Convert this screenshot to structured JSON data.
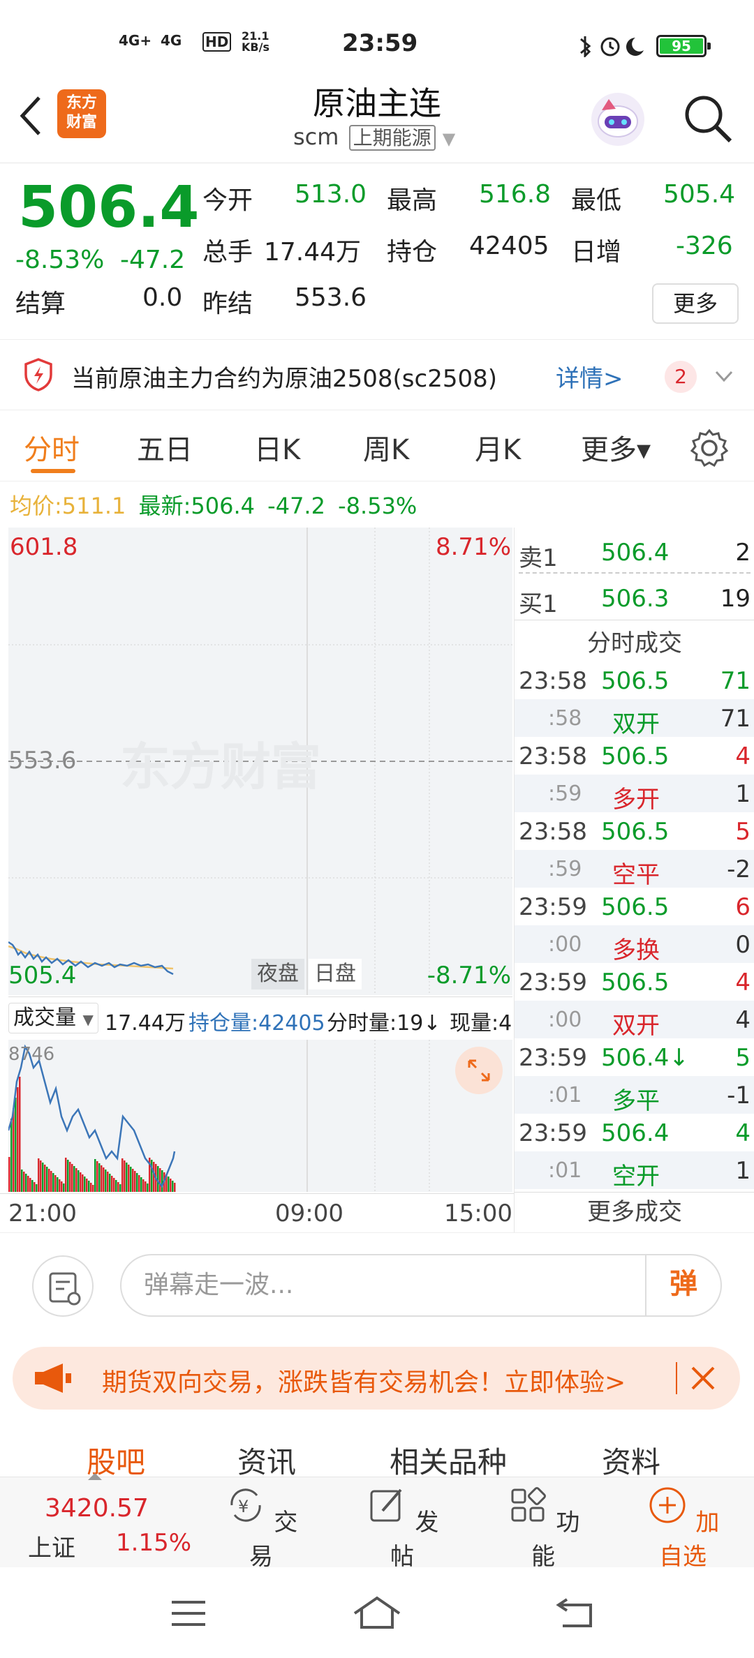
{
  "status_bar": {
    "time": "23:59",
    "net1": "4G+",
    "net2": "4G",
    "hd": "HD",
    "speed": "21.1",
    "speed_unit": "KB/s",
    "battery": "95"
  },
  "header": {
    "logo_text_1": "东方",
    "logo_text_2": "财富",
    "title": "原油主连",
    "code": "scm",
    "exchange": "上期能源"
  },
  "quote": {
    "price": "506.4",
    "change_pct": "-8.53%",
    "change": "-47.2",
    "open_label": "今开",
    "open": "513.0",
    "high_label": "最高",
    "high": "516.8",
    "low_label": "最低",
    "low": "505.4",
    "volume_label": "总手",
    "volume": "17.44万",
    "oi_label": "持仓",
    "oi": "42405",
    "oi_change_label": "日增",
    "oi_change": "-326",
    "settle_label": "结算",
    "settle": "0.0",
    "prev_settle_label": "昨结",
    "prev_settle": "553.6",
    "more": "更多"
  },
  "notice": {
    "text": "当前原油主力合约为原油2508(sc2508)",
    "link": "详情>",
    "count": "2"
  },
  "tabs": [
    "分时",
    "五日",
    "日K",
    "周K",
    "月K",
    "更多▾"
  ],
  "avg_line": {
    "avg_label": "均价:",
    "avg": "511.1",
    "latest_label": "最新:",
    "latest": "506.4",
    "change": "-47.2",
    "pct": "-8.53%"
  },
  "chart": {
    "top_price": "601.8",
    "top_pct": "8.71%",
    "mid_price": "553.6",
    "bottom_price": "505.4",
    "bottom_pct": "-8.71%",
    "watermark": "东方财富",
    "night_label": "夜盘",
    "day_label": "日盘"
  },
  "volume_bar": {
    "label": "成交量",
    "volume": "17.44万",
    "oi_text": "持仓量:42405",
    "tick_vol": "分时量:19↓",
    "now_vol": "现量:4",
    "max": "8746"
  },
  "time_axis": [
    "21:00",
    "09:00",
    "15:00"
  ],
  "book": {
    "sell_label": "卖1",
    "sell_price": "506.4",
    "sell_qty": "2",
    "buy_label": "买1",
    "buy_price": "506.3",
    "buy_qty": "19",
    "trades_title": "分时成交",
    "more_trades": "更多成交",
    "rows": [
      {
        "t": "23:58",
        "p": "506.5",
        "q": "71",
        "pc": "green",
        "qc": "green"
      },
      {
        "t": ":58",
        "p": "双开",
        "q": "71",
        "pc": "green",
        "qc": "gray"
      },
      {
        "t": "23:58",
        "p": "506.5",
        "q": "4",
        "pc": "green",
        "qc": "red"
      },
      {
        "t": ":59",
        "p": "多开",
        "q": "1",
        "pc": "red",
        "qc": "gray"
      },
      {
        "t": "23:58",
        "p": "506.5",
        "q": "5",
        "pc": "green",
        "qc": "red"
      },
      {
        "t": ":59",
        "p": "空平",
        "q": "-2",
        "pc": "red",
        "qc": "gray"
      },
      {
        "t": "23:59",
        "p": "506.5",
        "q": "6",
        "pc": "green",
        "qc": "red"
      },
      {
        "t": ":00",
        "p": "多换",
        "q": "0",
        "pc": "red",
        "qc": "gray"
      },
      {
        "t": "23:59",
        "p": "506.5",
        "q": "4",
        "pc": "green",
        "qc": "red"
      },
      {
        "t": ":00",
        "p": "双开",
        "q": "4",
        "pc": "red",
        "qc": "gray"
      },
      {
        "t": "23:59",
        "p": "506.4↓",
        "q": "5",
        "pc": "green",
        "qc": "green"
      },
      {
        "t": ":01",
        "p": "多平",
        "q": "-1",
        "pc": "green",
        "qc": "gray"
      },
      {
        "t": "23:59",
        "p": "506.4",
        "q": "4",
        "pc": "green",
        "qc": "green"
      },
      {
        "t": ":01",
        "p": "空开",
        "q": "1",
        "pc": "green",
        "qc": "gray"
      }
    ]
  },
  "comment": {
    "placeholder": "弹幕走一波...",
    "send": "弹"
  },
  "promo": {
    "text": "期货双向交易，涨跌皆有交易机会！立即体验>"
  },
  "sub_tabs": [
    "股吧",
    "资讯",
    "相关品种",
    "资料"
  ],
  "bottom_nav": {
    "index_value": "3420.57",
    "index_name": "上证",
    "index_pct": "1.15%",
    "trade": "交易",
    "post": "发帖",
    "func": "功能",
    "add": "加自选"
  }
}
